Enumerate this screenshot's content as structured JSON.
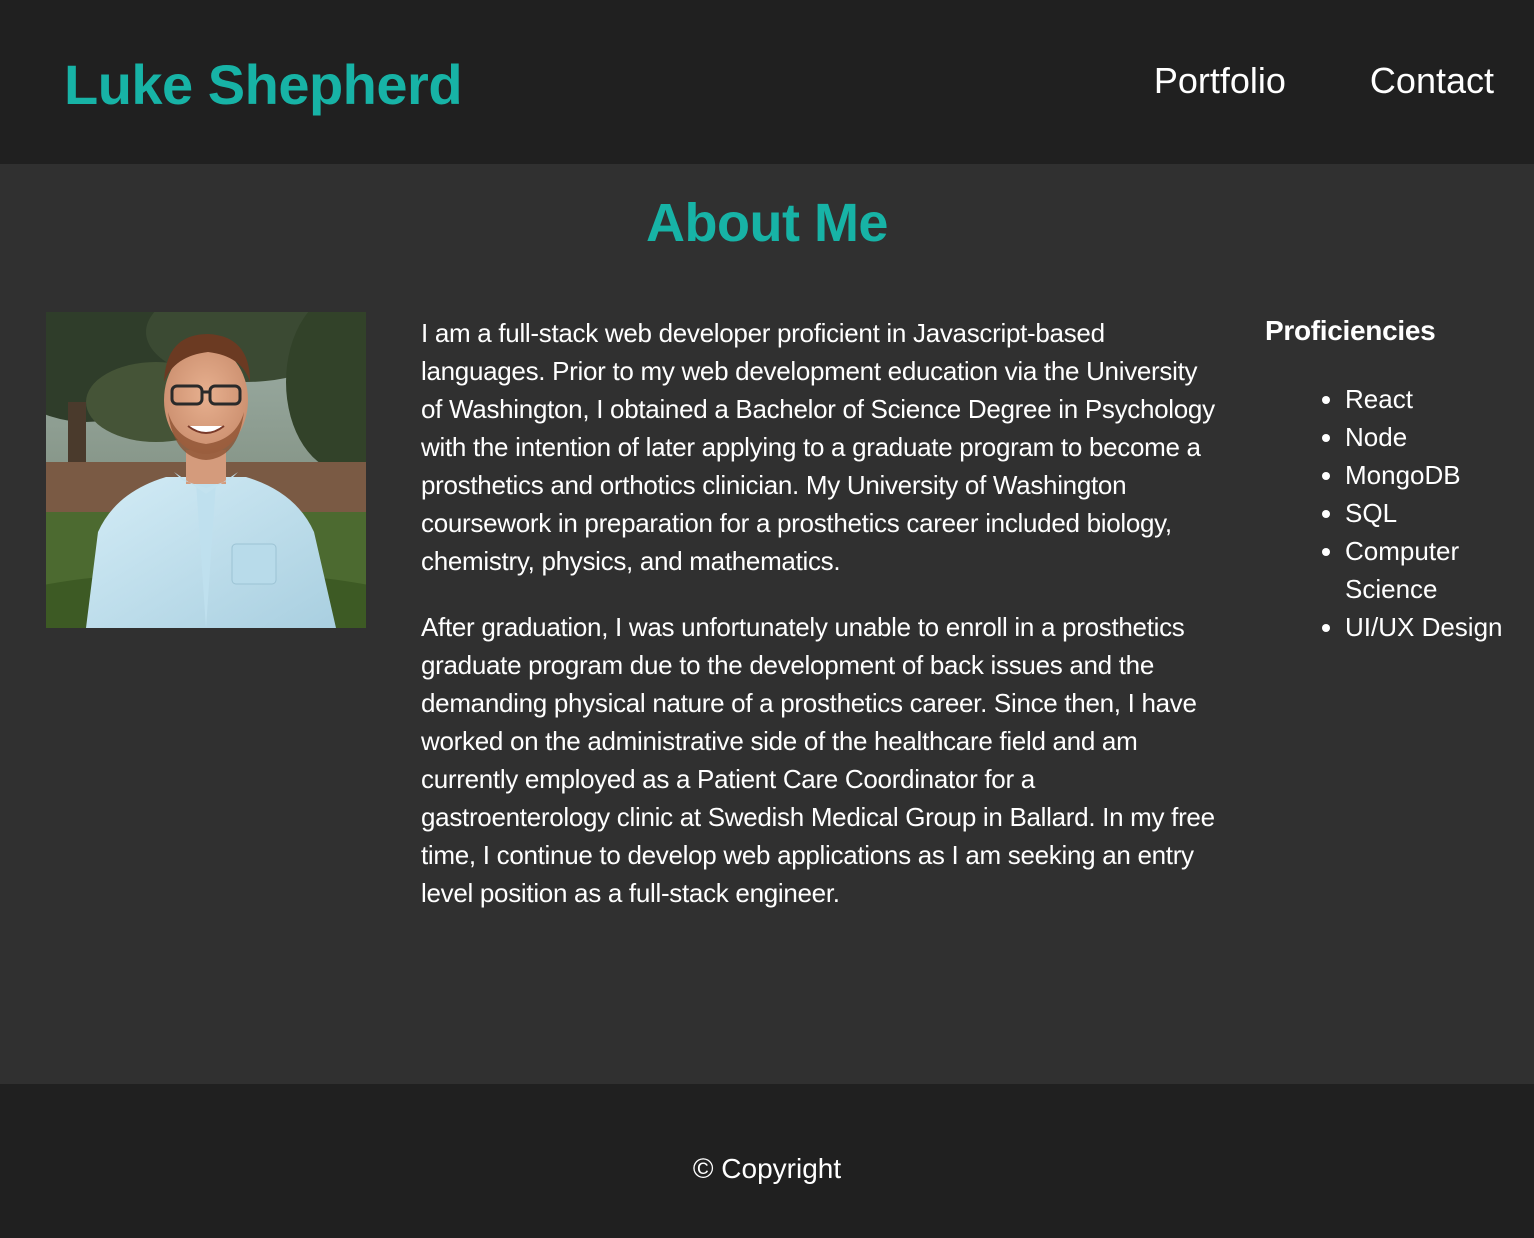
{
  "header": {
    "brand": "Luke Shepherd",
    "nav": [
      {
        "label": "Portfolio"
      },
      {
        "label": "Contact"
      }
    ]
  },
  "main": {
    "title": "About Me",
    "bio_paragraphs": [
      "I am a full-stack web developer proficient in Javascript-based languages. Prior to my web development education via the University of Washington, I obtained a Bachelor of Science Degree in Psychology with the intention of later applying to a graduate program to become a prosthetics and orthotics clinician. My University of Washington coursework in preparation for a prosthetics career included biology, chemistry, physics, and mathematics.",
      "After graduation, I was unfortunately unable to enroll in a prosthetics graduate program due to the development of back issues and the demanding physical nature of a prosthetics career. Since then, I have worked on the administrative side of the healthcare field and am currently employed as a Patient Care Coordinator for a gastroenterology clinic at Swedish Medical Group in Ballard. In my free time, I continue to develop web applications as I am seeking an entry level position as a full-stack engineer."
    ],
    "proficiencies": {
      "title": "Proficiencies",
      "items": [
        "React",
        "Node",
        "MongoDB",
        "SQL",
        "Computer Science",
        "UI/UX Design"
      ]
    }
  },
  "footer": {
    "copyright": "© Copyright"
  },
  "colors": {
    "accent": "#17b3a6",
    "header_bg": "#202020",
    "main_bg": "#303030",
    "text": "#ffffff"
  }
}
